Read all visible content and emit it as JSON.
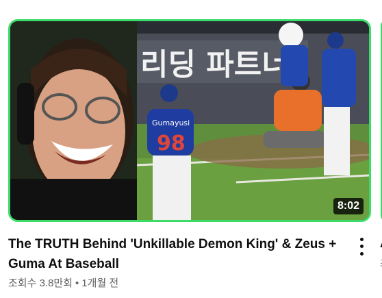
{
  "video": {
    "title": "The TRUTH Behind 'Unkillable Demon King' & Zeus + Guma At Baseball",
    "views": "조회수 3.8만회",
    "separator": "•",
    "age": "1개월 전",
    "duration": "8:02"
  },
  "thumbnail": {
    "banner_text": "리딩 파트너",
    "jersey_name": "Gumayusi",
    "jersey_number": "98"
  },
  "next_video": {
    "title_fragment": "A",
    "meta_fragment": "조"
  },
  "icons": {
    "menu": "more-vertical-icon"
  },
  "colors": {
    "highlight_border": "#3ddc6a",
    "title_text": "#0f0f0f",
    "meta_text": "#606060"
  }
}
